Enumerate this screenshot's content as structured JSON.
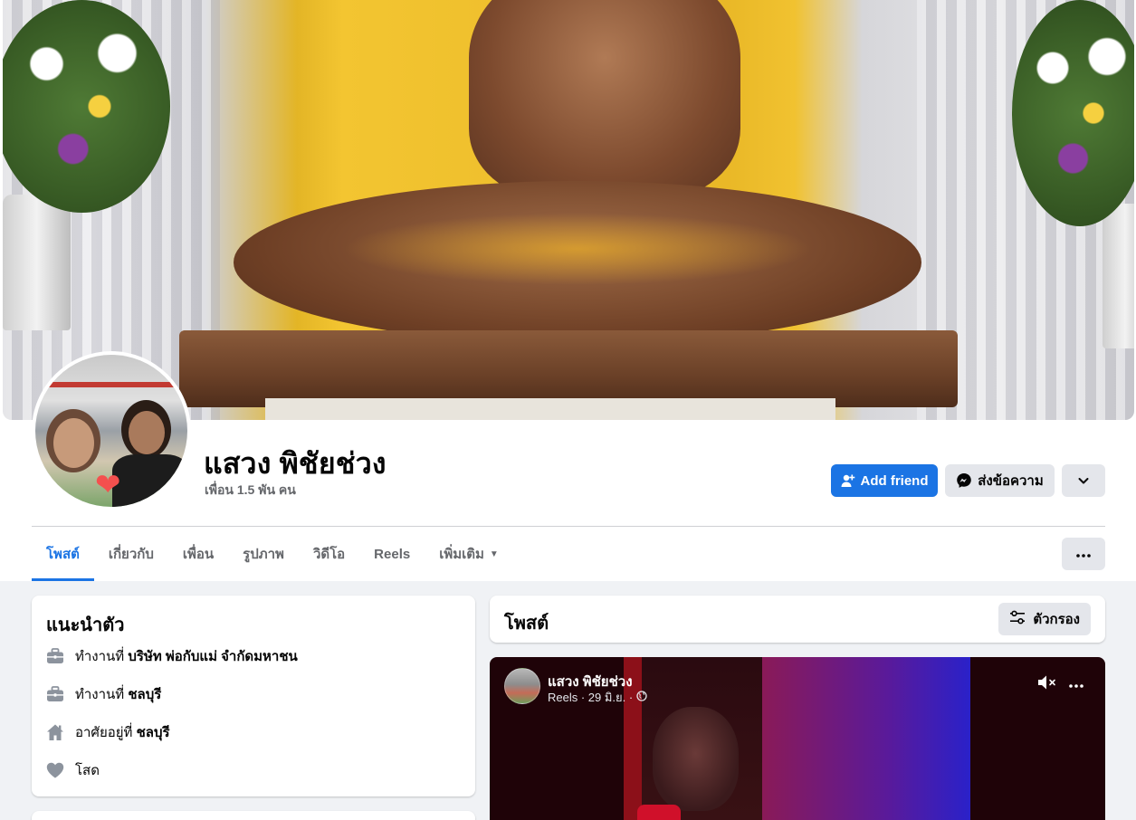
{
  "profile": {
    "name": "แสวง พิชัยช่วง",
    "friends": "เพื่อน 1.5 พัน คน"
  },
  "actions": {
    "add_friend": "Add friend",
    "message": "ส่งข้อความ",
    "more_icon": "chevron-down-icon"
  },
  "tabs": [
    {
      "label": "โพสต์",
      "active": true
    },
    {
      "label": "เกี่ยวกับ"
    },
    {
      "label": "เพื่อน"
    },
    {
      "label": "รูปภาพ"
    },
    {
      "label": "วิดีโอ"
    },
    {
      "label": "Reels"
    },
    {
      "label": "เพิ่มเติม"
    }
  ],
  "intro": {
    "title": "แนะนำตัว",
    "items": [
      {
        "icon": "briefcase-icon",
        "prefix": "ทำงานที่",
        "value": "บริษัท พ่อกับแม่ จำกัดมหาชน"
      },
      {
        "icon": "briefcase-icon",
        "prefix": "ทำงานที่",
        "value": "ชลบุรี"
      },
      {
        "icon": "home-icon",
        "prefix": "อาศัยอยู่ที่",
        "value": "ชลบุรี"
      },
      {
        "icon": "heart-icon",
        "prefix": "โสด",
        "value": ""
      }
    ]
  },
  "posts": {
    "title": "โพสต์",
    "filter_label": "ตัวกรอง"
  },
  "reel_post": {
    "author": "แสวง พิชัยช่วง",
    "meta": "Reels · 29 มิ.ย. ·"
  },
  "colors": {
    "primary": "#1b74e4",
    "background": "#f0f2f5",
    "secondary_button": "#e4e6eb",
    "muted_text": "#65676b"
  }
}
